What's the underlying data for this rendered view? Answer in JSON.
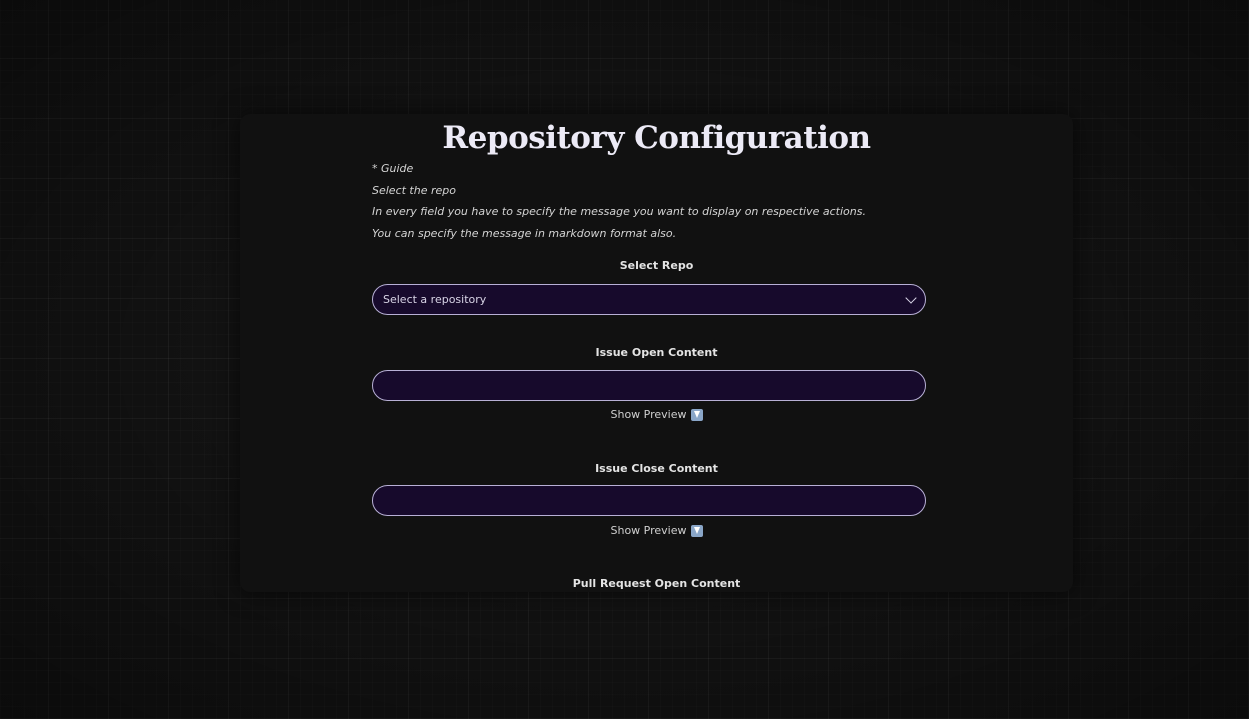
{
  "page": {
    "title": "Repository Configuration"
  },
  "guide": {
    "lines": [
      "* Guide",
      "Select the repo",
      "In every field you have to specify the message you want to display on respective actions.",
      "You can specify the message in markdown format also."
    ]
  },
  "repo": {
    "label": "Select Repo",
    "selected": "Select a repository"
  },
  "issue_open": {
    "label": "Issue Open Content",
    "value": "",
    "preview_label": "Show Preview"
  },
  "issue_close": {
    "label": "Issue Close Content",
    "value": "",
    "preview_label": "Show Preview"
  },
  "pr_open": {
    "label": "Pull Request Open Content"
  },
  "colors": {
    "background": "#141414",
    "card": "#111111",
    "field_bg": "#170a2c",
    "field_border": "#b8b0d6",
    "title": "#eceaf6"
  },
  "icons": {
    "preview": "down-arrow-icon",
    "select": "chevron-down-icon"
  }
}
